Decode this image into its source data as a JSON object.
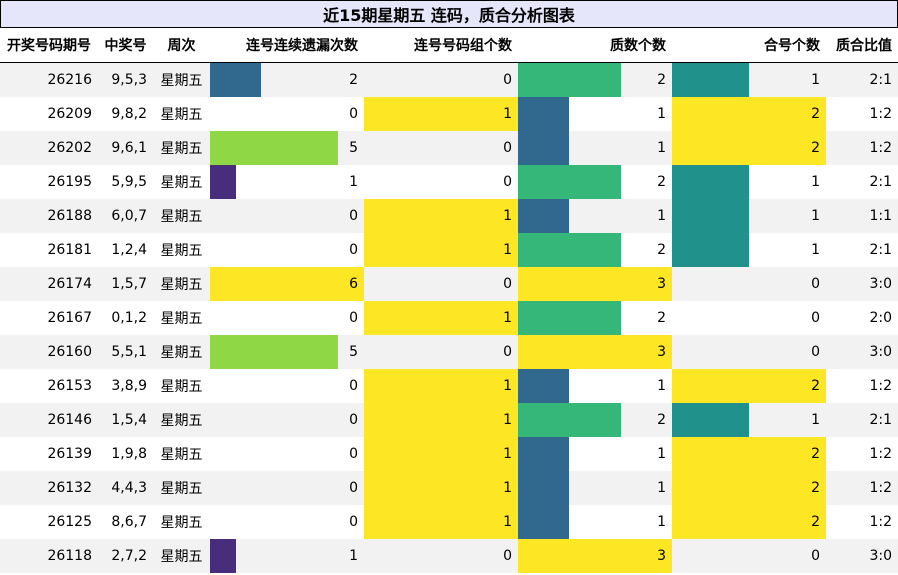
{
  "title": "近15期星期五 连码，质合分析图表",
  "columns": [
    "开奖号码期号",
    "中奖号",
    "周次",
    "连号连续遗漏次数",
    "连号号码组个数",
    "质数个数",
    "合号个数",
    "质合比值"
  ],
  "chart_data": {
    "type": "table",
    "title": "近15期星期五 连码，质合分析图表",
    "columns": [
      "开奖号码期号",
      "中奖号",
      "周次",
      "连号连续遗漏次数",
      "连号号码组个数",
      "质数个数",
      "合号个数",
      "质合比值"
    ],
    "bar_max": {
      "miss": 6,
      "groups": 1,
      "primes": 3,
      "composites": 2
    },
    "palette": {
      "1": "#472d7b",
      "2": "#31688e",
      "3": "#35b779",
      "5": "#8fd744",
      "6": "#fde725"
    },
    "palette_groups": {
      "1": "#fde725"
    },
    "palette_primes": {
      "1": "#31688e",
      "2": "#35b779",
      "3": "#fde725"
    },
    "palette_composites": {
      "1": "#21918c",
      "2": "#fde725"
    },
    "rows": [
      {
        "issue": "26216",
        "number": "9,5,3",
        "week": "星期五",
        "miss": 2,
        "groups": 0,
        "primes": 2,
        "composites": 1,
        "ratio": "2:1"
      },
      {
        "issue": "26209",
        "number": "9,8,2",
        "week": "星期五",
        "miss": 0,
        "groups": 1,
        "primes": 1,
        "composites": 2,
        "ratio": "1:2"
      },
      {
        "issue": "26202",
        "number": "9,6,1",
        "week": "星期五",
        "miss": 5,
        "groups": 0,
        "primes": 1,
        "composites": 2,
        "ratio": "1:2"
      },
      {
        "issue": "26195",
        "number": "5,9,5",
        "week": "星期五",
        "miss": 1,
        "groups": 0,
        "primes": 2,
        "composites": 1,
        "ratio": "2:1"
      },
      {
        "issue": "26188",
        "number": "6,0,7",
        "week": "星期五",
        "miss": 0,
        "groups": 1,
        "primes": 1,
        "composites": 1,
        "ratio": "1:1"
      },
      {
        "issue": "26181",
        "number": "1,2,4",
        "week": "星期五",
        "miss": 0,
        "groups": 1,
        "primes": 2,
        "composites": 1,
        "ratio": "2:1"
      },
      {
        "issue": "26174",
        "number": "1,5,7",
        "week": "星期五",
        "miss": 6,
        "groups": 0,
        "primes": 3,
        "composites": 0,
        "ratio": "3:0"
      },
      {
        "issue": "26167",
        "number": "0,1,2",
        "week": "星期五",
        "miss": 0,
        "groups": 1,
        "primes": 2,
        "composites": 0,
        "ratio": "2:0"
      },
      {
        "issue": "26160",
        "number": "5,5,1",
        "week": "星期五",
        "miss": 5,
        "groups": 0,
        "primes": 3,
        "composites": 0,
        "ratio": "3:0"
      },
      {
        "issue": "26153",
        "number": "3,8,9",
        "week": "星期五",
        "miss": 0,
        "groups": 1,
        "primes": 1,
        "composites": 2,
        "ratio": "1:2"
      },
      {
        "issue": "26146",
        "number": "1,5,4",
        "week": "星期五",
        "miss": 0,
        "groups": 1,
        "primes": 2,
        "composites": 1,
        "ratio": "2:1"
      },
      {
        "issue": "26139",
        "number": "1,9,8",
        "week": "星期五",
        "miss": 0,
        "groups": 1,
        "primes": 1,
        "composites": 2,
        "ratio": "1:2"
      },
      {
        "issue": "26132",
        "number": "4,4,3",
        "week": "星期五",
        "miss": 0,
        "groups": 1,
        "primes": 1,
        "composites": 2,
        "ratio": "1:2"
      },
      {
        "issue": "26125",
        "number": "8,6,7",
        "week": "星期五",
        "miss": 0,
        "groups": 1,
        "primes": 1,
        "composites": 2,
        "ratio": "1:2"
      },
      {
        "issue": "26118",
        "number": "2,7,2",
        "week": "星期五",
        "miss": 1,
        "groups": 0,
        "primes": 3,
        "composites": 0,
        "ratio": "3:0"
      }
    ]
  }
}
